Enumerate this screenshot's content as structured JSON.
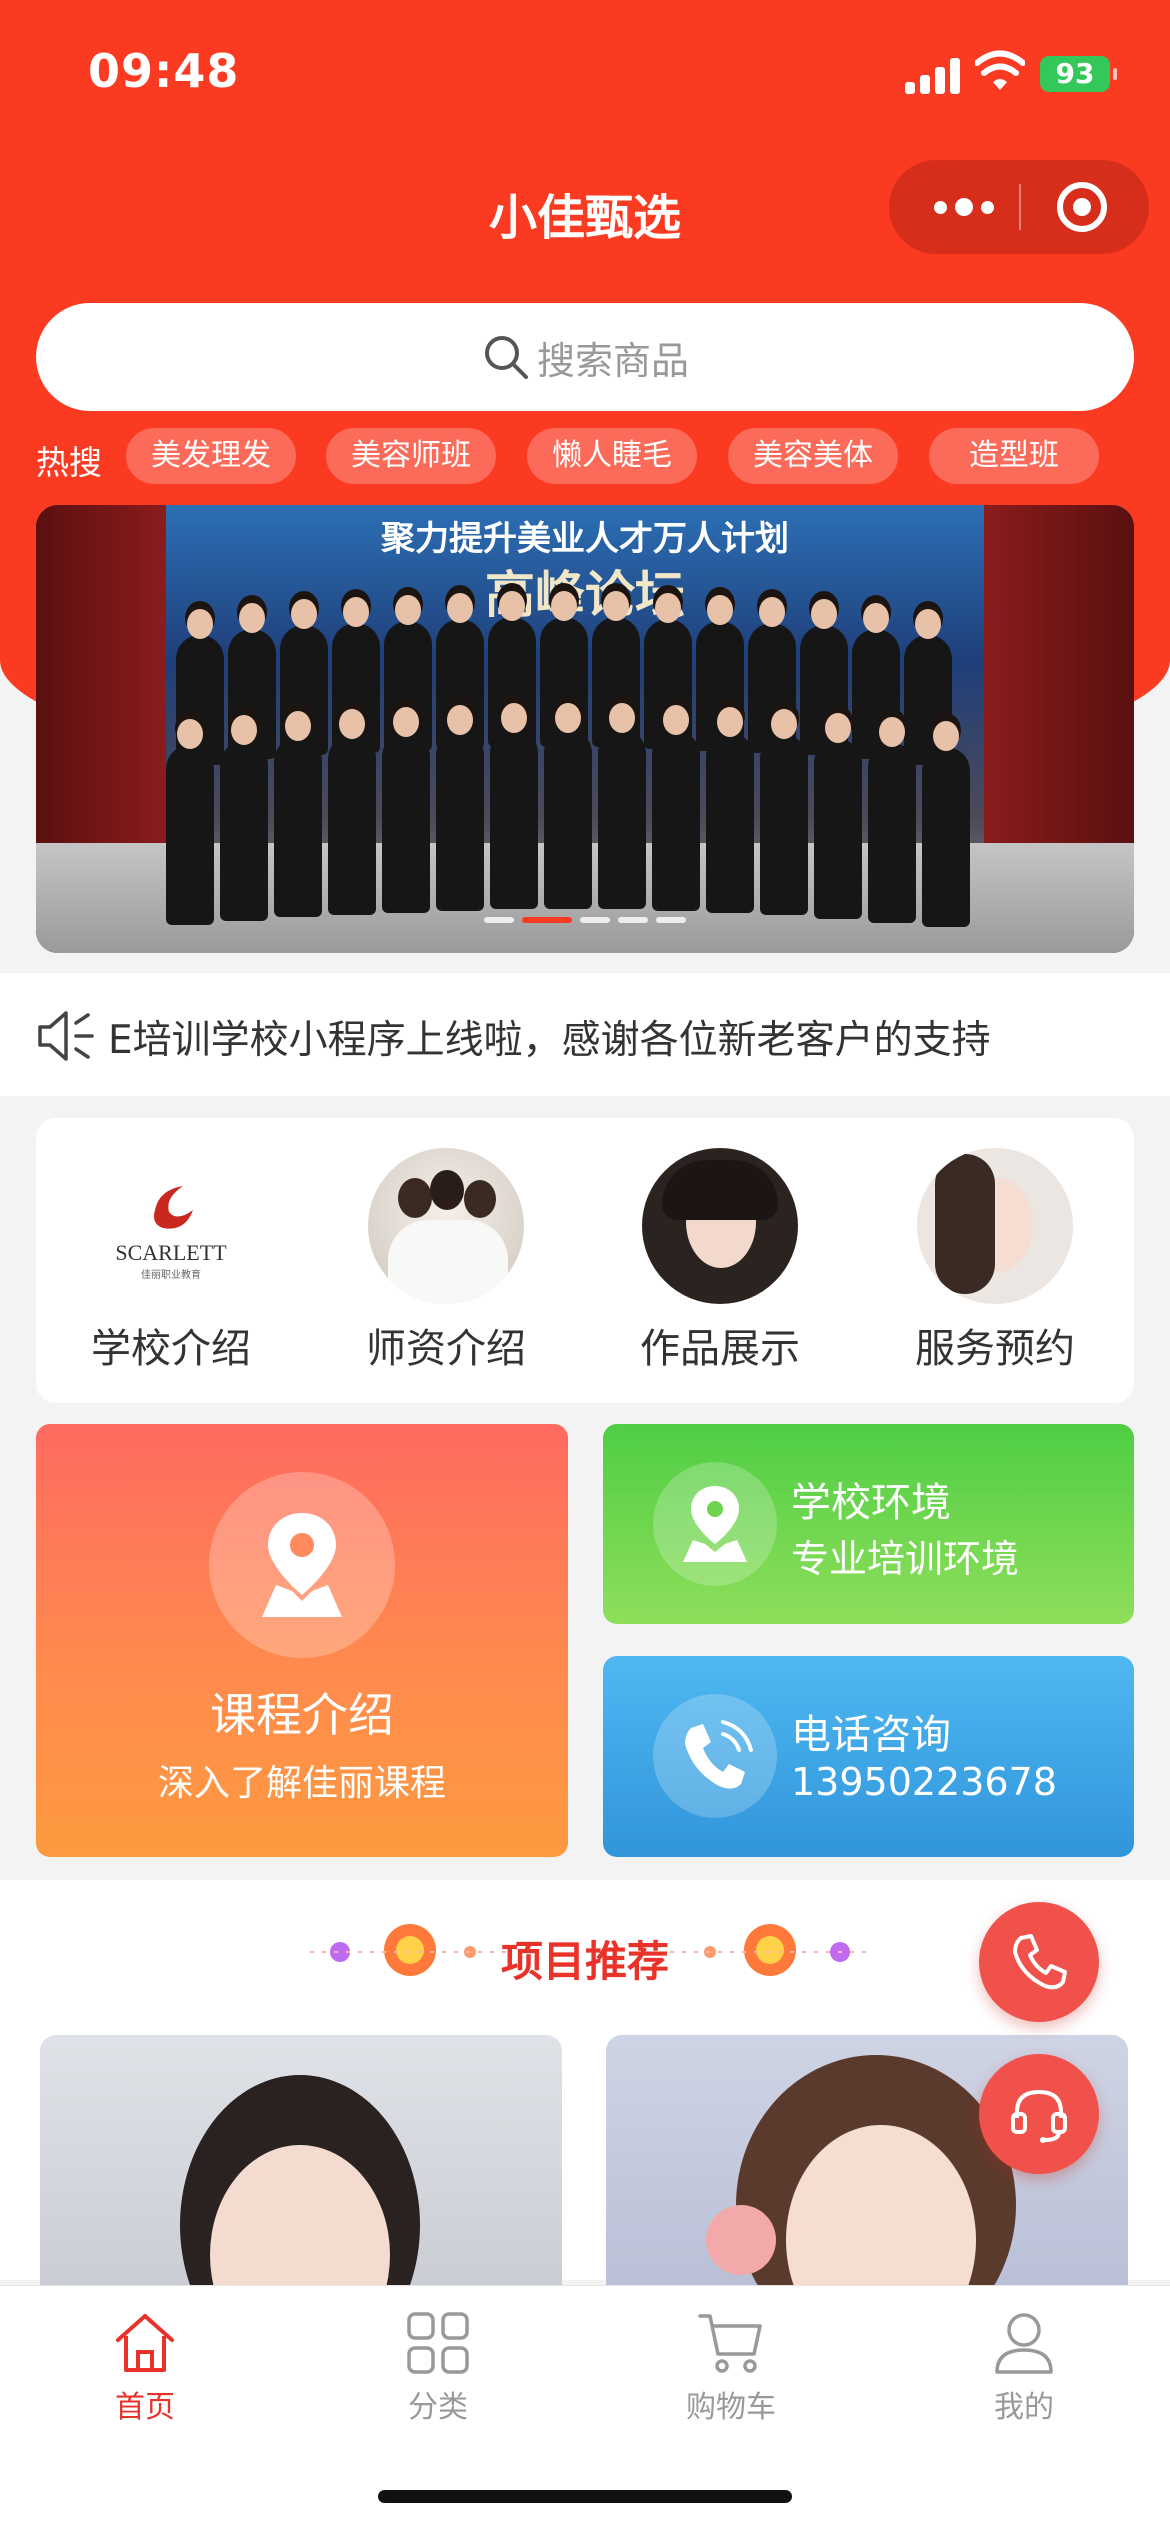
{
  "status_bar": {
    "time": "09:48",
    "battery": "93"
  },
  "nav": {
    "title": "小佳甄选"
  },
  "search": {
    "placeholder": "搜索商品"
  },
  "hot_search": {
    "label": "热搜",
    "tags": [
      "美发理发",
      "美容师班",
      "懒人睫毛",
      "美容美体",
      "造型班"
    ]
  },
  "banner": {
    "headline": "聚力提升美业人才万人计划",
    "subheadline": "高峰论坛",
    "active_index": 1,
    "count": 5
  },
  "notice": {
    "text": "E培训学校小程序上线啦，感谢各位新老客户的支持"
  },
  "features": [
    {
      "label": "学校介绍",
      "logo_text": "SCARLETT",
      "logo_sub": "佳丽职业教育"
    },
    {
      "label": "师资介绍"
    },
    {
      "label": "作品展示"
    },
    {
      "label": "服务预约"
    }
  ],
  "promos": {
    "course": {
      "title": "课程介绍",
      "subtitle": "深入了解佳丽课程",
      "icon": "map-pin-icon"
    },
    "environment": {
      "title": "学校环境",
      "subtitle": "专业培训环境",
      "icon": "map-pin-icon"
    },
    "phone": {
      "title": "电话咨询",
      "subtitle": "13950223678",
      "icon": "phone-icon"
    }
  },
  "recommend": {
    "title": "项目推荐"
  },
  "tabbar": [
    {
      "label": "首页",
      "icon": "home-icon",
      "active": true
    },
    {
      "label": "分类",
      "icon": "grid-icon",
      "active": false
    },
    {
      "label": "购物车",
      "icon": "cart-icon",
      "active": false
    },
    {
      "label": "我的",
      "icon": "user-icon",
      "active": false
    }
  ],
  "colors": {
    "primary": "#fb3a22",
    "accent_text": "#e8322a"
  }
}
